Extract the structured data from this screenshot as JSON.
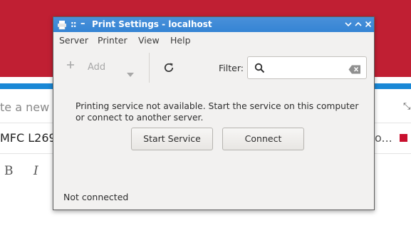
{
  "background": {
    "new_task_placeholder": "te a new T",
    "printer_name": "MFC L269",
    "ellipsis": "o...",
    "bold_label": "B",
    "italic_label": "I"
  },
  "window": {
    "title": "Print Settings - localhost",
    "titlebar_left_glyphs": "::",
    "titlebar_dash": "–"
  },
  "menu": {
    "items": [
      {
        "label": "Server"
      },
      {
        "label": "Printer"
      },
      {
        "label": "View"
      },
      {
        "label": "Help"
      }
    ]
  },
  "toolbar": {
    "add_label": "Add",
    "filter_label": "Filter:",
    "filter_value": "",
    "filter_placeholder": ""
  },
  "content": {
    "message": "Printing service not available.  Start the service on this computer or connect to another server.",
    "start_service_label": "Start Service",
    "connect_label": "Connect"
  },
  "status": {
    "text": "Not connected"
  },
  "icons": {
    "titlebar": [
      "printer-icon",
      "grip-icon",
      "minimize-icon",
      "minimize-button-icon",
      "maximize-button-icon",
      "close-button-icon"
    ],
    "toolbar": [
      "plus-icon",
      "chevron-down-icon",
      "refresh-icon",
      "search-icon",
      "clear-icon"
    ]
  },
  "colors": {
    "banner": "#c01f33",
    "accent_blue": "#1a88d6",
    "titlebar": "#3584d4",
    "window_bg": "#f2f1f0"
  }
}
